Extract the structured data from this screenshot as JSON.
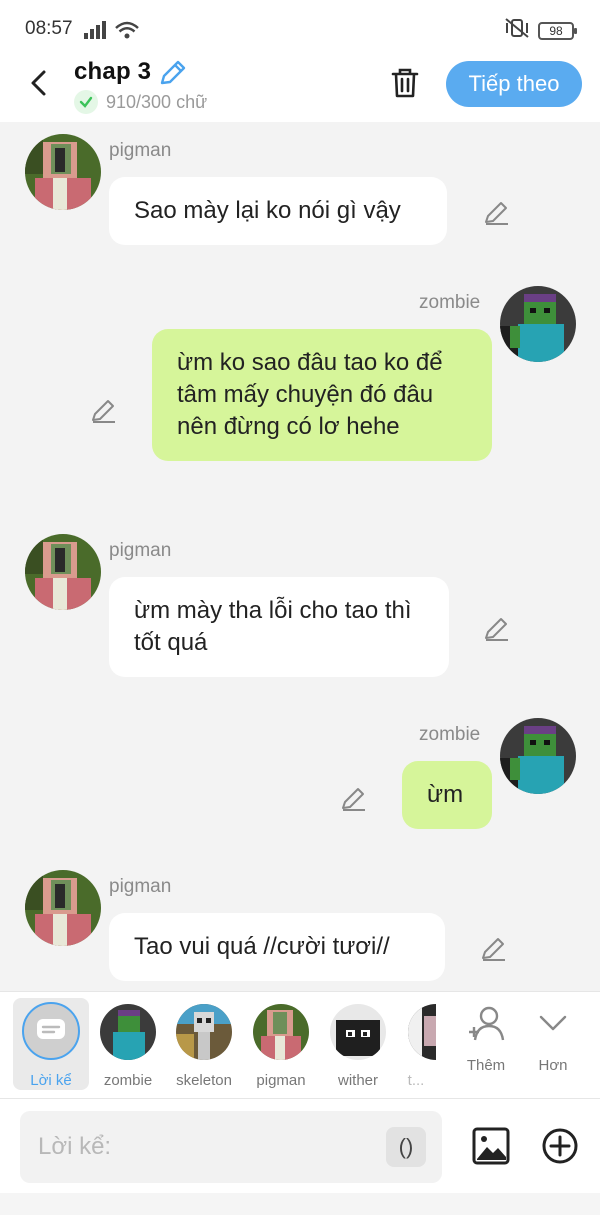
{
  "status_bar": {
    "time": "08:57",
    "battery": "98"
  },
  "header": {
    "title": "chap 3",
    "word_count": "910/300 chữ",
    "next_label": "Tiếp theo"
  },
  "messages": [
    {
      "speaker": "pigman",
      "side": "left",
      "text": "Sao mày lại ko nói gì vậy"
    },
    {
      "speaker": "zombie",
      "side": "right",
      "text": "ừm ko sao đâu tao ko để tâm mấy chuyện đó đâu nên đừng có lơ hehe"
    },
    {
      "speaker": "pigman",
      "side": "left",
      "text": "ừm mày tha lỗi cho tao thì tốt quá"
    },
    {
      "speaker": "zombie",
      "side": "right",
      "text": "ừm"
    },
    {
      "speaker": "pigman",
      "side": "left",
      "text": "Tao vui quá //cười tươi//"
    }
  ],
  "characters": [
    {
      "label": "Lời kể",
      "selected": true
    },
    {
      "label": "zombie"
    },
    {
      "label": "skeleton"
    },
    {
      "label": "pigman"
    },
    {
      "label": "wither"
    },
    {
      "label": "t..."
    }
  ],
  "tools": {
    "add_label": "Thêm",
    "more_label": "Hơn"
  },
  "input": {
    "placeholder": "Lời kể:",
    "paren": "()"
  },
  "colors": {
    "accent": "#5aabf0",
    "right_bubble": "#d6f59a",
    "left_bubble": "#ffffff",
    "background": "#f3f3f3"
  }
}
